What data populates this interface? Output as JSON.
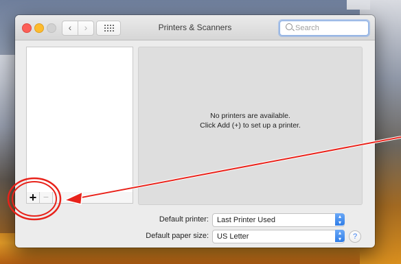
{
  "window": {
    "title": "Printers & Scanners"
  },
  "toolbar": {
    "back_icon": "‹",
    "forward_icon": "›"
  },
  "search": {
    "placeholder": "Search"
  },
  "list": {
    "add_label": "+",
    "remove_label": "−"
  },
  "detail": {
    "message_line1": "No printers are available.",
    "message_line2": "Click Add (+) to set up a printer."
  },
  "defaults": {
    "printer_label": "Default printer:",
    "printer_value": "Last Printer Used",
    "paper_label": "Default paper size:",
    "paper_value": "US Letter"
  },
  "help": {
    "label": "?"
  },
  "colors": {
    "annotation": "#e8221a",
    "accent": "#3a7ef0"
  }
}
